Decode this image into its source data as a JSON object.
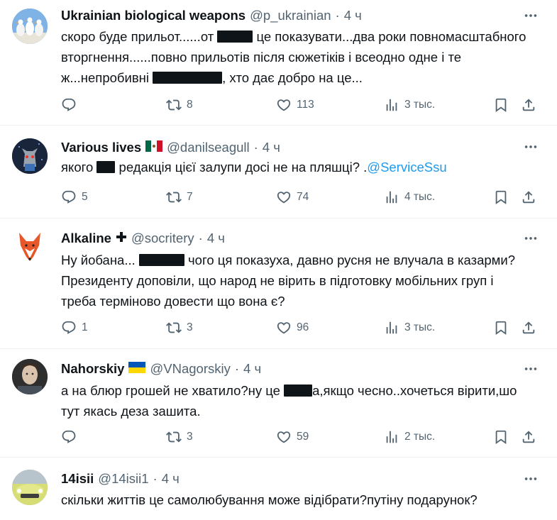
{
  "tweets": [
    {
      "name": "Ukrainian biological weapons",
      "handle": "@p_ukrainian",
      "time": "4 ч",
      "text_parts": [
        "скоро буде прильот......от ",
        " це показувати...два роки повномасштабного вторгнення......повно прильотів після сюжетіків і всеодно одне і те ж...непробивні ",
        ", хто дає добро на це..."
      ],
      "replies": "",
      "retweets": "8",
      "likes": "113",
      "views": "3 тыс."
    },
    {
      "name": "Various lives",
      "handle": "@danilseagull",
      "time": "4 ч",
      "text_parts": [
        "якого ",
        " редакція цієї залупи досі не на пляшці? ."
      ],
      "mention": "@ServiceSsu",
      "replies": "5",
      "retweets": "7",
      "likes": "74",
      "views": "4 тыс."
    },
    {
      "name": "Alkaline",
      "handle": "@socritery",
      "time": "4 ч",
      "text_parts": [
        "Ну йобана... ",
        " чого ця показуха, давно русня не влучала в казарми? Президенту доповіли, що народ не вірить в підготовку мобільних груп і треба терміново довести що вона є?"
      ],
      "replies": "1",
      "retweets": "3",
      "likes": "96",
      "views": "3 тыс."
    },
    {
      "name": "Nahorskiy",
      "handle": "@VNagorskiy",
      "time": "4 ч",
      "text_parts": [
        "а на блюр грошей не хватило?ну це ",
        "а,якщо чесно..хочеться вірити,шо тут якась деза зашита."
      ],
      "replies": "",
      "retweets": "3",
      "likes": "59",
      "views": "2 тыс."
    },
    {
      "name": "14isii",
      "handle": "@14isii1",
      "time": "4 ч",
      "text_parts": [
        "скільки життів це самолюбування може відібрати?путіну подарунок?"
      ]
    }
  ],
  "colors": {
    "text": "#0f1419",
    "secondary": "#536471",
    "link": "#1d9bf0",
    "divider": "#eff3f4"
  },
  "icons": [
    "reply-icon",
    "retweet-icon",
    "like-icon",
    "views-icon",
    "bookmark-icon",
    "share-icon",
    "more-icon",
    "heavy-plus-icon",
    "mexico-flag-icon",
    "ukraine-flag-icon"
  ]
}
